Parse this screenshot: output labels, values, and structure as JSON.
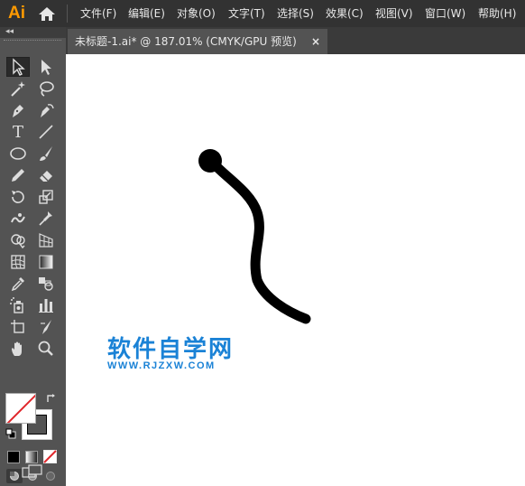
{
  "app": {
    "logo_text": "Ai"
  },
  "menu": {
    "items": [
      "文件(F)",
      "编辑(E)",
      "对象(O)",
      "文字(T)",
      "选择(S)",
      "效果(C)",
      "视图(V)",
      "窗口(W)",
      "帮助(H)"
    ]
  },
  "document": {
    "tab_title": "未标题-1.ai* @ 187.01% (CMYK/GPU 预览)",
    "close_label": "×"
  },
  "toolbar": {
    "collapse_label": "◂◂",
    "tools": [
      "selection-tool-icon",
      "direct-selection-tool-icon",
      "magic-wand-tool-icon",
      "lasso-tool-icon",
      "pen-tool-icon",
      "curvature-tool-icon",
      "type-tool-icon",
      "line-segment-tool-icon",
      "ellipse-tool-icon",
      "paintbrush-tool-icon",
      "pencil-tool-icon",
      "eraser-tool-icon",
      "rotate-tool-icon",
      "scale-tool-icon",
      "warp-tool-icon",
      "puppet-warp-tool-icon",
      "shape-builder-tool-icon",
      "perspective-grid-tool-icon",
      "mesh-tool-icon",
      "gradient-tool-icon",
      "eyedropper-tool-icon",
      "blend-tool-icon",
      "symbol-sprayer-tool-icon",
      "column-graph-tool-icon",
      "artboard-tool-icon",
      "slice-tool-icon",
      "hand-tool-icon",
      "zoom-tool-icon"
    ],
    "type_tool_glyph": "T"
  },
  "watermark": {
    "main": "软件自学网",
    "sub": "WWW.RJZXW.COM"
  },
  "colors": {
    "menubar": "#323232",
    "panel": "#535353",
    "canvas": "#ffffff",
    "accent_logo": "#ff9a00",
    "watermark": "#1a82d6",
    "stroke_path": "#000000"
  }
}
